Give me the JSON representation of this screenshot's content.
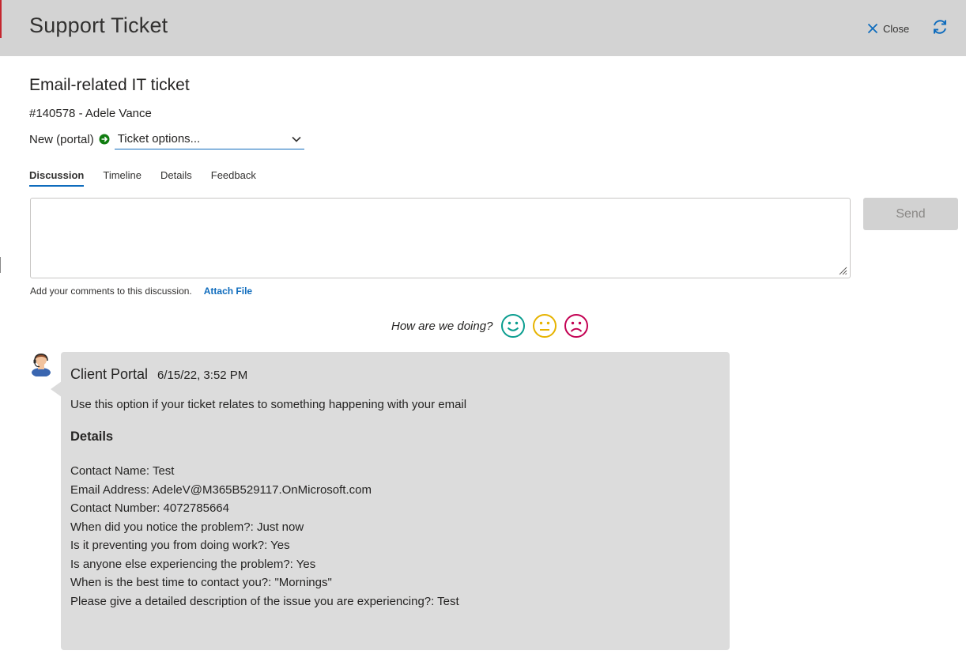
{
  "header": {
    "title": "Support Ticket",
    "close_label": "Close"
  },
  "ticket": {
    "title": "Email-related IT ticket",
    "meta": "#140578 - Adele Vance",
    "status": "New (portal)",
    "options_label": "Ticket options..."
  },
  "tabs": [
    {
      "label": "Discussion",
      "active": true
    },
    {
      "label": "Timeline",
      "active": false
    },
    {
      "label": "Details",
      "active": false
    },
    {
      "label": "Feedback",
      "active": false
    }
  ],
  "composer": {
    "value": "",
    "send_label": "Send",
    "hint": "Add your comments to this discussion.",
    "attach_label": "Attach File"
  },
  "feedback": {
    "question": "How are we doing?",
    "faces": [
      "happy-face-icon",
      "neutral-face-icon",
      "sad-face-icon"
    ]
  },
  "message": {
    "author": "Client Portal",
    "time": "6/15/22, 3:52 PM",
    "intro": "Use this option if your ticket relates to something happening with your email",
    "section_title": "Details",
    "lines": [
      "Contact Name: Test",
      "Email Address: AdeleV@M365B529117.OnMicrosoft.com",
      "Contact Number: 4072785664",
      "When did you notice the problem?: Just now",
      "Is it preventing you from doing work?: Yes",
      "Is anyone else experiencing the problem?: Yes",
      "When is the best time to contact you?: \"Mornings\"",
      "Please give a detailed description of the issue you are experiencing?: Test"
    ]
  },
  "colors": {
    "accent": "#0f6cbd",
    "header_bg": "#d3d3d3",
    "bubble_bg": "#dcdcdc",
    "status_green": "#107c10",
    "happy": "#0a9d8f",
    "neutral": "#e6b300",
    "sad": "#c30052"
  }
}
